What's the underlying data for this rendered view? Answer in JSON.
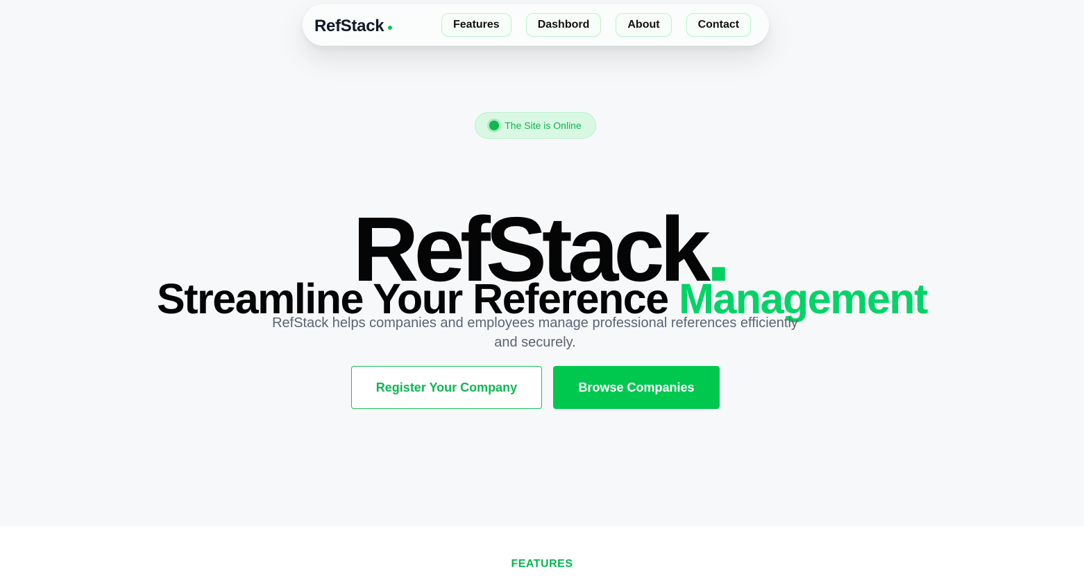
{
  "nav": {
    "brand": "RefStack",
    "links": [
      {
        "label": "Features"
      },
      {
        "label": "Dashbord"
      },
      {
        "label": "About"
      },
      {
        "label": "Contact"
      }
    ]
  },
  "hero": {
    "status": "The Site is Online",
    "title": "RefStack",
    "title_suffix": ".",
    "subtitle_main": "Streamline Your Reference",
    "subtitle_highlight": "Management",
    "description": "RefStack helps companies and employees manage professional references efficiently and securely.",
    "primary_cta": "Register Your Company",
    "secondary_cta": "Browse Companies"
  },
  "features": {
    "label": "FEATURES"
  },
  "colors": {
    "accent": "#00c84f",
    "accent_light": "#d9f8e3",
    "text_dark": "#050505",
    "text_muted": "#5c6472",
    "background": "#f6f8fa"
  }
}
